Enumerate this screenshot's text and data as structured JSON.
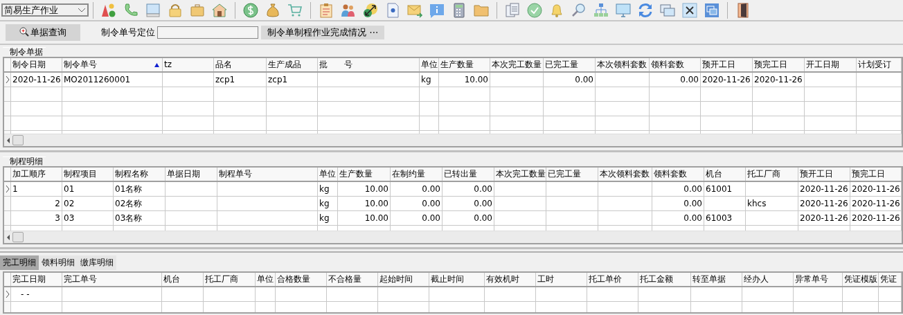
{
  "toolbar": {
    "module_select": "简易生产作业"
  },
  "query_bar": {
    "query_button": "单据查询",
    "locate_label": "制令单号定位",
    "status_button": "制令单制程作业完成情况 ⋯"
  },
  "orders": {
    "title": "制令单据",
    "columns": [
      {
        "label": "制令日期"
      },
      {
        "label": "制令单号",
        "sort_ascending": true
      },
      {
        "label": "tz"
      },
      {
        "label": "品名"
      },
      {
        "label": "生产成品"
      },
      {
        "label": "批　　号"
      },
      {
        "label": "单位"
      },
      {
        "label": "生产数量",
        "kind": "number"
      },
      {
        "label": "本次完工数量"
      },
      {
        "label": "已完工量",
        "kind": "number"
      },
      {
        "label": "本次领料套数"
      },
      {
        "label": "领料套数",
        "kind": "number"
      },
      {
        "label": "预开工日"
      },
      {
        "label": "预完工日"
      },
      {
        "label": "开工日期"
      },
      {
        "label": "计划受订"
      }
    ],
    "rows": [
      {
        "current": true,
        "cells": [
          "2020-11-26",
          "MO2011260001",
          "",
          "zcp1",
          "zcp1",
          "",
          "kg",
          "10.00",
          "",
          "0.00",
          "",
          "0.00",
          "2020-11-26",
          "2020-11-26",
          "",
          ""
        ]
      }
    ]
  },
  "processes": {
    "title": "制程明细",
    "columns": [
      {
        "label": "加工顺序",
        "kind": "number"
      },
      {
        "label": "制程项目"
      },
      {
        "label": "制程名称"
      },
      {
        "label": "单据日期"
      },
      {
        "label": "制程单号"
      },
      {
        "label": "单位"
      },
      {
        "label": "生产数量",
        "kind": "number"
      },
      {
        "label": "在制约量",
        "kind": "number"
      },
      {
        "label": "已转出量",
        "kind": "number"
      },
      {
        "label": "本次完工数量"
      },
      {
        "label": "已完工量"
      },
      {
        "label": "本次领料套数"
      },
      {
        "label": "领料套数",
        "kind": "number"
      },
      {
        "label": "机台"
      },
      {
        "label": "托工厂商"
      },
      {
        "label": "预开工日"
      },
      {
        "label": "预完工日"
      }
    ],
    "rows": [
      {
        "current": true,
        "cells": [
          "1",
          "01",
          "01名称",
          "",
          "",
          "kg",
          "10.00",
          "0.00",
          "0.00",
          "",
          "",
          "",
          "0.00",
          "61001",
          "",
          "2020-11-26",
          "2020-11-26"
        ]
      },
      {
        "current": false,
        "cells": [
          "2",
          "02",
          "02名称",
          "",
          "",
          "kg",
          "10.00",
          "0.00",
          "0.00",
          "",
          "",
          "",
          "0.00",
          "",
          "khcs",
          "2020-11-26",
          "2020-11-26"
        ]
      },
      {
        "current": false,
        "cells": [
          "3",
          "03",
          "03名称",
          "",
          "",
          "kg",
          "10.00",
          "0.00",
          "0.00",
          "",
          "",
          "",
          "0.00",
          "61003",
          "",
          "2020-11-26",
          "2020-11-26"
        ]
      }
    ]
  },
  "detail_tabs": [
    {
      "label": "完工明细",
      "selected": true
    },
    {
      "label": "领料明细",
      "selected": false
    },
    {
      "label": "缴库明细",
      "selected": false
    }
  ],
  "completions": {
    "columns": [
      {
        "label": "完工日期"
      },
      {
        "label": "完工单号"
      },
      {
        "label": "机台"
      },
      {
        "label": "托工厂商"
      },
      {
        "label": "单位"
      },
      {
        "label": "合格数量"
      },
      {
        "label": "不合格量"
      },
      {
        "label": "起始时间"
      },
      {
        "label": "截止时间"
      },
      {
        "label": "有效机时"
      },
      {
        "label": "工时"
      },
      {
        "label": "托工单价"
      },
      {
        "label": "托工金额"
      },
      {
        "label": "转至单据"
      },
      {
        "label": "经办人"
      },
      {
        "label": "异常单号"
      },
      {
        "label": "凭证模版"
      },
      {
        "label": "凭证"
      }
    ],
    "rows": [
      {
        "current": true,
        "cells": [
          "　- -",
          "",
          "",
          "",
          "",
          "",
          "",
          "",
          "",
          "",
          "",
          "",
          "",
          "",
          "",
          "",
          "",
          ""
        ]
      }
    ]
  }
}
